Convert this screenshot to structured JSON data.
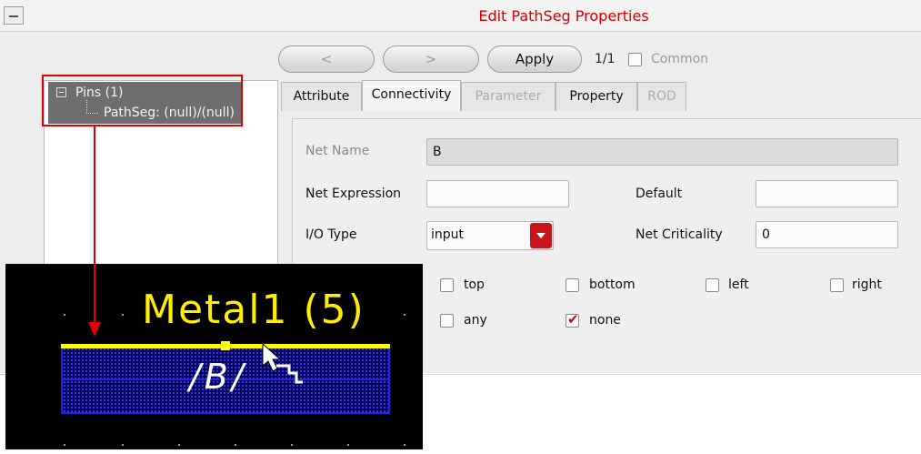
{
  "window": {
    "title": "Edit PathSeg Properties"
  },
  "toolbar": {
    "prev_label": "<",
    "next_label": ">",
    "apply_label": "Apply",
    "page_counter": "1/1",
    "common_label": "Common",
    "common_checked": false
  },
  "tree": {
    "root_label": "Pins (1)",
    "child_label": "PathSeg: (null)/(null)"
  },
  "tabs": [
    {
      "label": "Attribute",
      "enabled": true
    },
    {
      "label": "Connectivity",
      "enabled": true,
      "active": true
    },
    {
      "label": "Parameter",
      "enabled": false
    },
    {
      "label": "Property",
      "enabled": true
    },
    {
      "label": "ROD",
      "enabled": false
    }
  ],
  "connectivity": {
    "net_name_label": "Net Name",
    "net_name_value": "B",
    "net_expression_label": "Net Expression",
    "net_expression_value": "",
    "default_label": "Default",
    "default_value": "",
    "io_type_label": "I/O Type",
    "io_type_value": "input",
    "net_criticality_label": "Net Criticality",
    "net_criticality_value": "0",
    "access_directions": [
      {
        "label": "top",
        "checked": false
      },
      {
        "label": "bottom",
        "checked": false
      },
      {
        "label": "left",
        "checked": false
      },
      {
        "label": "right",
        "checked": false
      },
      {
        "label": "any",
        "checked": false
      },
      {
        "label": "none",
        "checked": true
      }
    ]
  },
  "viewer": {
    "layer_label": "Metal1 (5)",
    "net_label": "/B/"
  },
  "colors": {
    "title": "#d40000",
    "callout": "#e00000",
    "path": "#ffff00",
    "metal": "#2424e0"
  }
}
